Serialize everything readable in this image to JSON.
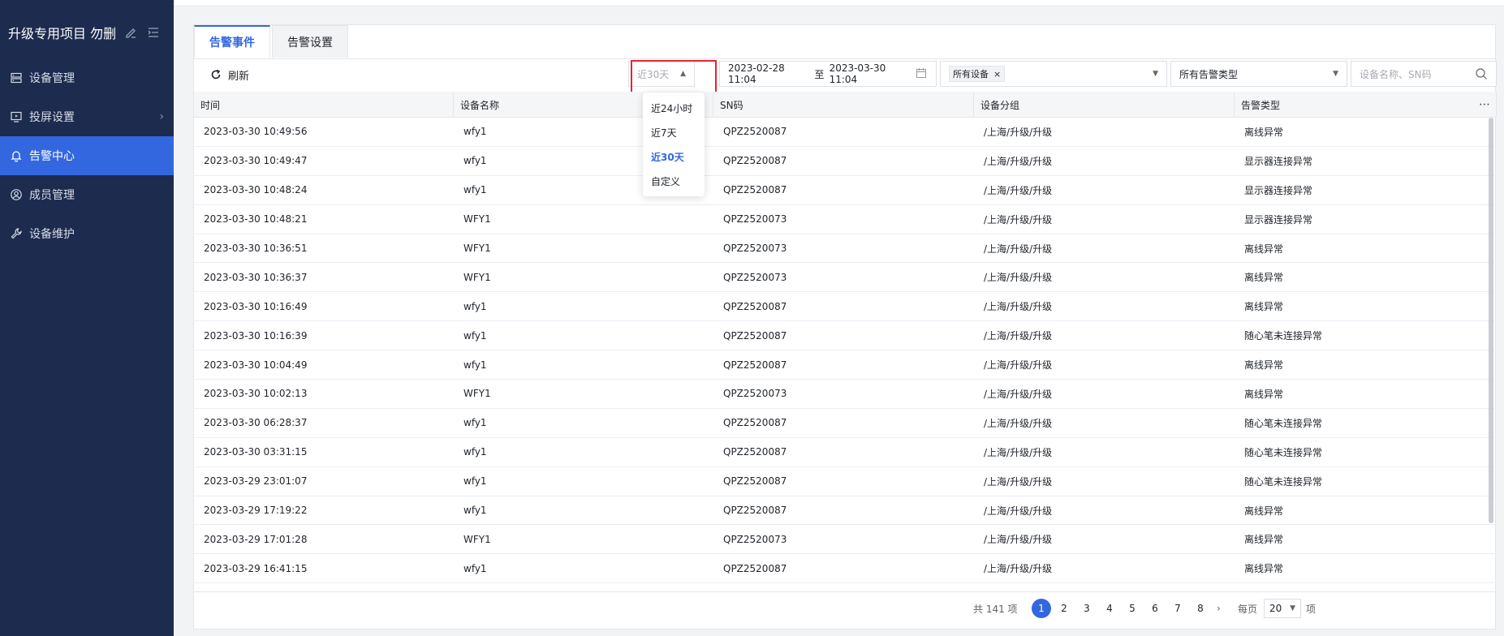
{
  "sidebar": {
    "project_title": "升级专用项目 勿删",
    "items": [
      {
        "label": "设备管理",
        "icon": "server-icon",
        "active": false,
        "has_chevron": false
      },
      {
        "label": "投屏设置",
        "icon": "monitor-icon",
        "active": false,
        "has_chevron": true
      },
      {
        "label": "告警中心",
        "icon": "bell-icon",
        "active": true,
        "has_chevron": false
      },
      {
        "label": "成员管理",
        "icon": "user-circle-icon",
        "active": false,
        "has_chevron": false
      },
      {
        "label": "设备维护",
        "icon": "wrench-icon",
        "active": false,
        "has_chevron": false
      }
    ]
  },
  "tabs": [
    {
      "label": "告警事件",
      "active": true
    },
    {
      "label": "告警设置",
      "active": false
    }
  ],
  "toolbar": {
    "refresh_label": "刷新",
    "range_value": "近30天",
    "date_start": "2023-02-28 11:04",
    "date_sep": "至",
    "date_end": "2023-03-30 11:04",
    "device_tag": "所有设备",
    "type_value": "所有告警类型",
    "search_placeholder": "设备名称、SN码"
  },
  "range_options": [
    {
      "label": "近24小时",
      "selected": false
    },
    {
      "label": "近7天",
      "selected": false
    },
    {
      "label": "近30天",
      "selected": true
    },
    {
      "label": "自定义",
      "selected": false
    }
  ],
  "table": {
    "columns": [
      "时间",
      "设备名称",
      "SN码",
      "设备分组",
      "告警类型"
    ],
    "rows": [
      [
        "2023-03-30 10:49:56",
        "wfy1",
        "QPZ2520087",
        "/上海/升级/升级",
        "离线异常"
      ],
      [
        "2023-03-30 10:49:47",
        "wfy1",
        "QPZ2520087",
        "/上海/升级/升级",
        "显示器连接异常"
      ],
      [
        "2023-03-30 10:48:24",
        "wfy1",
        "QPZ2520087",
        "/上海/升级/升级",
        "显示器连接异常"
      ],
      [
        "2023-03-30 10:48:21",
        "WFY1",
        "QPZ2520073",
        "/上海/升级/升级",
        "显示器连接异常"
      ],
      [
        "2023-03-30 10:36:51",
        "WFY1",
        "QPZ2520073",
        "/上海/升级/升级",
        "离线异常"
      ],
      [
        "2023-03-30 10:36:37",
        "WFY1",
        "QPZ2520073",
        "/上海/升级/升级",
        "离线异常"
      ],
      [
        "2023-03-30 10:16:49",
        "wfy1",
        "QPZ2520087",
        "/上海/升级/升级",
        "离线异常"
      ],
      [
        "2023-03-30 10:16:39",
        "wfy1",
        "QPZ2520087",
        "/上海/升级/升级",
        "随心笔未连接异常"
      ],
      [
        "2023-03-30 10:04:49",
        "wfy1",
        "QPZ2520087",
        "/上海/升级/升级",
        "离线异常"
      ],
      [
        "2023-03-30 10:02:13",
        "WFY1",
        "QPZ2520073",
        "/上海/升级/升级",
        "离线异常"
      ],
      [
        "2023-03-30 06:28:37",
        "wfy1",
        "QPZ2520087",
        "/上海/升级/升级",
        "随心笔未连接异常"
      ],
      [
        "2023-03-30 03:31:15",
        "wfy1",
        "QPZ2520087",
        "/上海/升级/升级",
        "随心笔未连接异常"
      ],
      [
        "2023-03-29 23:01:07",
        "wfy1",
        "QPZ2520087",
        "/上海/升级/升级",
        "随心笔未连接异常"
      ],
      [
        "2023-03-29 17:19:22",
        "wfy1",
        "QPZ2520087",
        "/上海/升级/升级",
        "离线异常"
      ],
      [
        "2023-03-29 17:01:28",
        "WFY1",
        "QPZ2520073",
        "/上海/升级/升级",
        "离线异常"
      ],
      [
        "2023-03-29 16:41:15",
        "wfy1",
        "QPZ2520087",
        "/上海/升级/升级",
        "离线异常"
      ]
    ]
  },
  "pager": {
    "total_label": "共 141 项",
    "pages": [
      "1",
      "2",
      "3",
      "4",
      "5",
      "6",
      "7",
      "8"
    ],
    "current": "1",
    "per_page_label": "每页",
    "page_size": "20",
    "unit_label": "项"
  },
  "colors": {
    "sidebar_bg": "#1d2b4f",
    "accent": "#3367e0",
    "highlight": "#e5252a"
  }
}
